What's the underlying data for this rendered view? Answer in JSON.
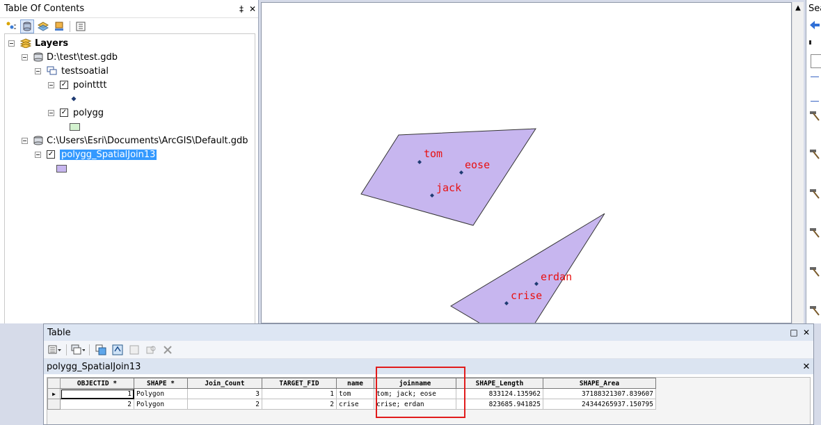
{
  "toc": {
    "title": "Table Of Contents",
    "pin_glyph": "‡",
    "close_glyph": "✕",
    "tree": {
      "root": "Layers",
      "db1": "D:\\test\\test.gdb",
      "dataset": "testsoatial",
      "layer_point": "pointttt",
      "layer_polygon": "polygg",
      "db2": "C:\\Users\\Esri\\Documents\\ArcGIS\\Default.gdb",
      "layer_join": "polygg_SpatialJoin13"
    }
  },
  "map": {
    "polygon_fill": "#c7b6ef",
    "point_color": "#1f3b73",
    "label_color": "#e81010",
    "labels": {
      "tom": "tom",
      "eose": "eose",
      "jack": "jack",
      "erdan": "erdan",
      "crise": "crise"
    }
  },
  "search_panel": {
    "title": "Sea"
  },
  "table_window": {
    "title": "Table",
    "maximize_glyph": "□",
    "close_glyph": "✕",
    "layer_tab": "polygg_SpatialJoin13",
    "layer_close": "✕",
    "columns": [
      "OBJECTID *",
      "SHAPE *",
      "Join_Count",
      "TARGET_FID",
      "name",
      "joinname",
      "SHAPE_Length",
      "SHAPE_Area"
    ],
    "rows": [
      [
        "1",
        "Polygon",
        "3",
        "1",
        "tom",
        "tom; jack; eose",
        "833124.135962",
        "37188321307.839607"
      ],
      [
        "2",
        "Polygon",
        "2",
        "2",
        "crise",
        "crise; erdan",
        "823685.941825",
        "24344265937.150795"
      ]
    ],
    "current_row_marker": "▶",
    "highlight_color": "#e11b1b"
  }
}
